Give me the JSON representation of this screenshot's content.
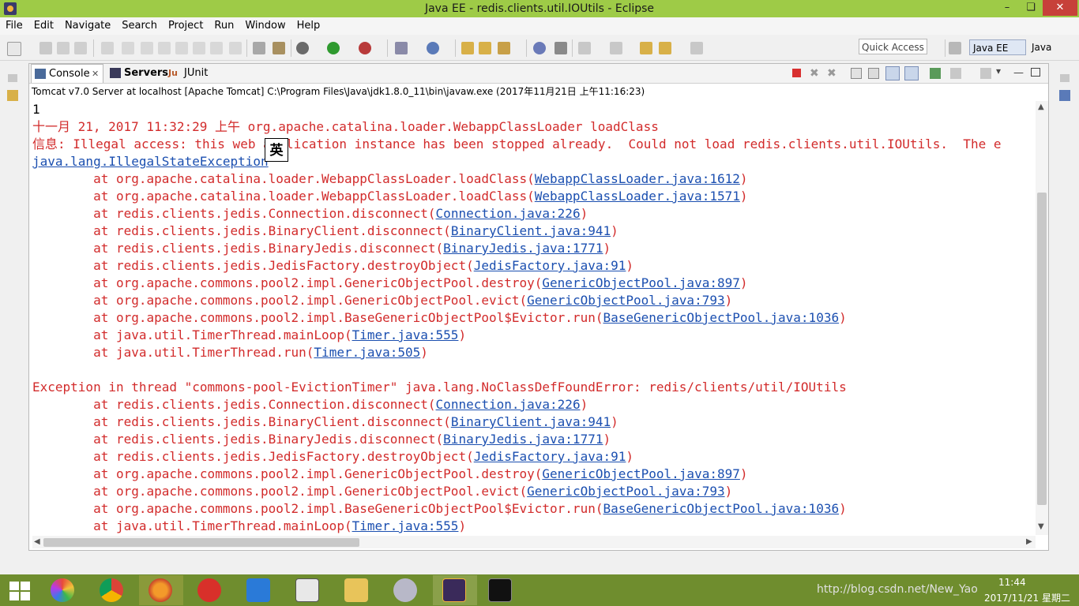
{
  "window": {
    "title": "Java EE - redis.clients.util.IOUtils - Eclipse",
    "minimize": "–",
    "restore": "❏",
    "close": "✕"
  },
  "menubar": [
    "File",
    "Edit",
    "Navigate",
    "Search",
    "Project",
    "Run",
    "Window",
    "Help"
  ],
  "toolbar": {
    "quick_access": "Quick Access",
    "perspectives": [
      "Java EE",
      "Java"
    ]
  },
  "view": {
    "tabs": [
      {
        "label": "Console",
        "icon": "console-icon"
      },
      {
        "label": "Servers",
        "icon": "servers-icon"
      },
      {
        "label": "JUnit",
        "icon": "junit-icon"
      }
    ],
    "description": "Tomcat v7.0 Server at localhost [Apache Tomcat] C:\\Program Files\\Java\\jdk1.8.0_11\\bin\\javaw.exe (2017年11月21日 上午11:16:23)"
  },
  "console": {
    "lines": [
      {
        "color": "blk",
        "text": "1"
      },
      {
        "color": "red",
        "text": "十一月 21, 2017 11:32:29 上午 org.apache.catalina.loader.WebappClassLoader loadClass"
      },
      {
        "color": "red",
        "text": "信息: Illegal access: this web application instance has been stopped already.  Could not load redis.clients.util.IOUtils.  The e"
      },
      {
        "color": "red",
        "text": "",
        "link": "java.lang.IllegalStateException"
      },
      {
        "color": "red",
        "text": "\tat org.apache.catalina.loader.WebappClassLoader.loadClass(",
        "link": "WebappClassLoader.java:1612",
        "after": ")"
      },
      {
        "color": "red",
        "text": "\tat org.apache.catalina.loader.WebappClassLoader.loadClass(",
        "link": "WebappClassLoader.java:1571",
        "after": ")"
      },
      {
        "color": "red",
        "text": "\tat redis.clients.jedis.Connection.disconnect(",
        "link": "Connection.java:226",
        "after": ")"
      },
      {
        "color": "red",
        "text": "\tat redis.clients.jedis.BinaryClient.disconnect(",
        "link": "BinaryClient.java:941",
        "after": ")"
      },
      {
        "color": "red",
        "text": "\tat redis.clients.jedis.BinaryJedis.disconnect(",
        "link": "BinaryJedis.java:1771",
        "after": ")"
      },
      {
        "color": "red",
        "text": "\tat redis.clients.jedis.JedisFactory.destroyObject(",
        "link": "JedisFactory.java:91",
        "after": ")"
      },
      {
        "color": "red",
        "text": "\tat org.apache.commons.pool2.impl.GenericObjectPool.destroy(",
        "link": "GenericObjectPool.java:897",
        "after": ")"
      },
      {
        "color": "red",
        "text": "\tat org.apache.commons.pool2.impl.GenericObjectPool.evict(",
        "link": "GenericObjectPool.java:793",
        "after": ")"
      },
      {
        "color": "red",
        "text": "\tat org.apache.commons.pool2.impl.BaseGenericObjectPool$Evictor.run(",
        "link": "BaseGenericObjectPool.java:1036",
        "after": ")"
      },
      {
        "color": "red",
        "text": "\tat java.util.TimerThread.mainLoop(",
        "link": "Timer.java:555",
        "after": ")"
      },
      {
        "color": "red",
        "text": "\tat java.util.TimerThread.run(",
        "link": "Timer.java:505",
        "after": ")"
      },
      {
        "color": "red",
        "text": ""
      },
      {
        "color": "red",
        "text": "Exception in thread \"commons-pool-EvictionTimer\" java.lang.NoClassDefFoundError: redis/clients/util/IOUtils"
      },
      {
        "color": "red",
        "text": "\tat redis.clients.jedis.Connection.disconnect(",
        "link": "Connection.java:226",
        "after": ")"
      },
      {
        "color": "red",
        "text": "\tat redis.clients.jedis.BinaryClient.disconnect(",
        "link": "BinaryClient.java:941",
        "after": ")"
      },
      {
        "color": "red",
        "text": "\tat redis.clients.jedis.BinaryJedis.disconnect(",
        "link": "BinaryJedis.java:1771",
        "after": ")"
      },
      {
        "color": "red",
        "text": "\tat redis.clients.jedis.JedisFactory.destroyObject(",
        "link": "JedisFactory.java:91",
        "after": ")"
      },
      {
        "color": "red",
        "text": "\tat org.apache.commons.pool2.impl.GenericObjectPool.destroy(",
        "link": "GenericObjectPool.java:897",
        "after": ")"
      },
      {
        "color": "red",
        "text": "\tat org.apache.commons.pool2.impl.GenericObjectPool.evict(",
        "link": "GenericObjectPool.java:793",
        "after": ")"
      },
      {
        "color": "red",
        "text": "\tat org.apache.commons.pool2.impl.BaseGenericObjectPool$Evictor.run(",
        "link": "BaseGenericObjectPool.java:1036",
        "after": ")"
      },
      {
        "color": "red",
        "text": "\tat java.util.TimerThread.mainLoop(",
        "link": "Timer.java:555",
        "after": ")"
      }
    ]
  },
  "ime_indicator": "英",
  "taskbar": {
    "time": "11:44",
    "date": "2017/11/21 星期二",
    "watermark": "http://blog.csdn.net/New_Yao"
  },
  "colors": {
    "titlebar": "#9ecb47",
    "console_error": "#d22b2b",
    "link": "#1b4fb0",
    "taskbar": "#6f8d2e"
  }
}
